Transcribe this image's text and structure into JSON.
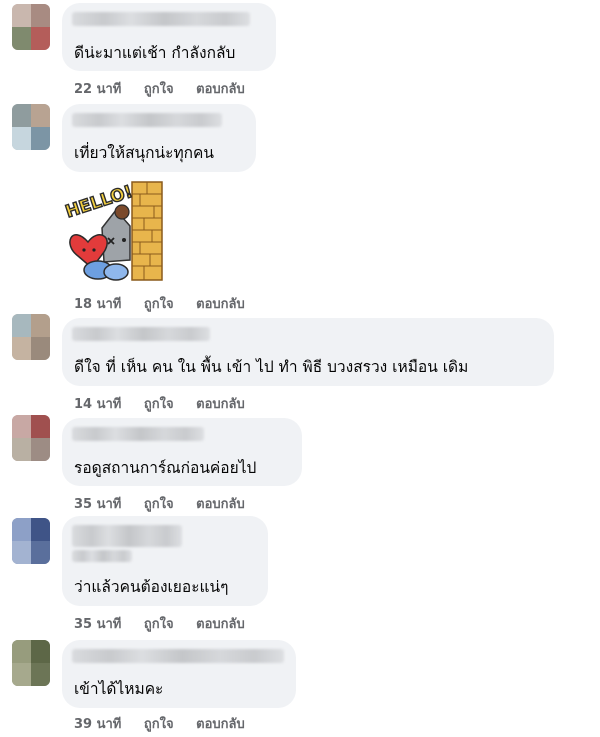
{
  "comments": [
    {
      "text": "ดีน่ะมาแต่เช้า กำลังกลับ",
      "time": "22 นาที",
      "like": "ถูกใจ",
      "reply": "ตอบกลับ"
    },
    {
      "text": "เที่ยวให้สนุกน่ะทุกคน",
      "time": "18 นาที",
      "like": "ถูกใจ",
      "reply": "ตอบกลับ",
      "sticker": "HELLO!"
    },
    {
      "text": "ดีใจ ที่ เห็น คน ใน พื้น เข้า ไป ทำ พิธี บวงสรวง เหมือน เดิม",
      "time": "14 นาที",
      "like": "ถูกใจ",
      "reply": "ตอบกลับ"
    },
    {
      "text": "รอดูสถานการ์ณก่อนค่อยไป",
      "time": "35 นาที",
      "like": "ถูกใจ",
      "reply": "ตอบกลับ"
    },
    {
      "text": "ว่าแล้วคนต้องเยอะแน่ๆ",
      "time": "35 นาที",
      "like": "ถูกใจ",
      "reply": "ตอบกลับ"
    },
    {
      "text": "เข้าได้ไหมคะ",
      "time": "39 นาที",
      "like": "ถูกใจ",
      "reply": "ตอบกลับ"
    }
  ],
  "colors": {
    "bubble": "#f0f2f5",
    "action_text": "#65676b",
    "comment_text": "#050505"
  }
}
